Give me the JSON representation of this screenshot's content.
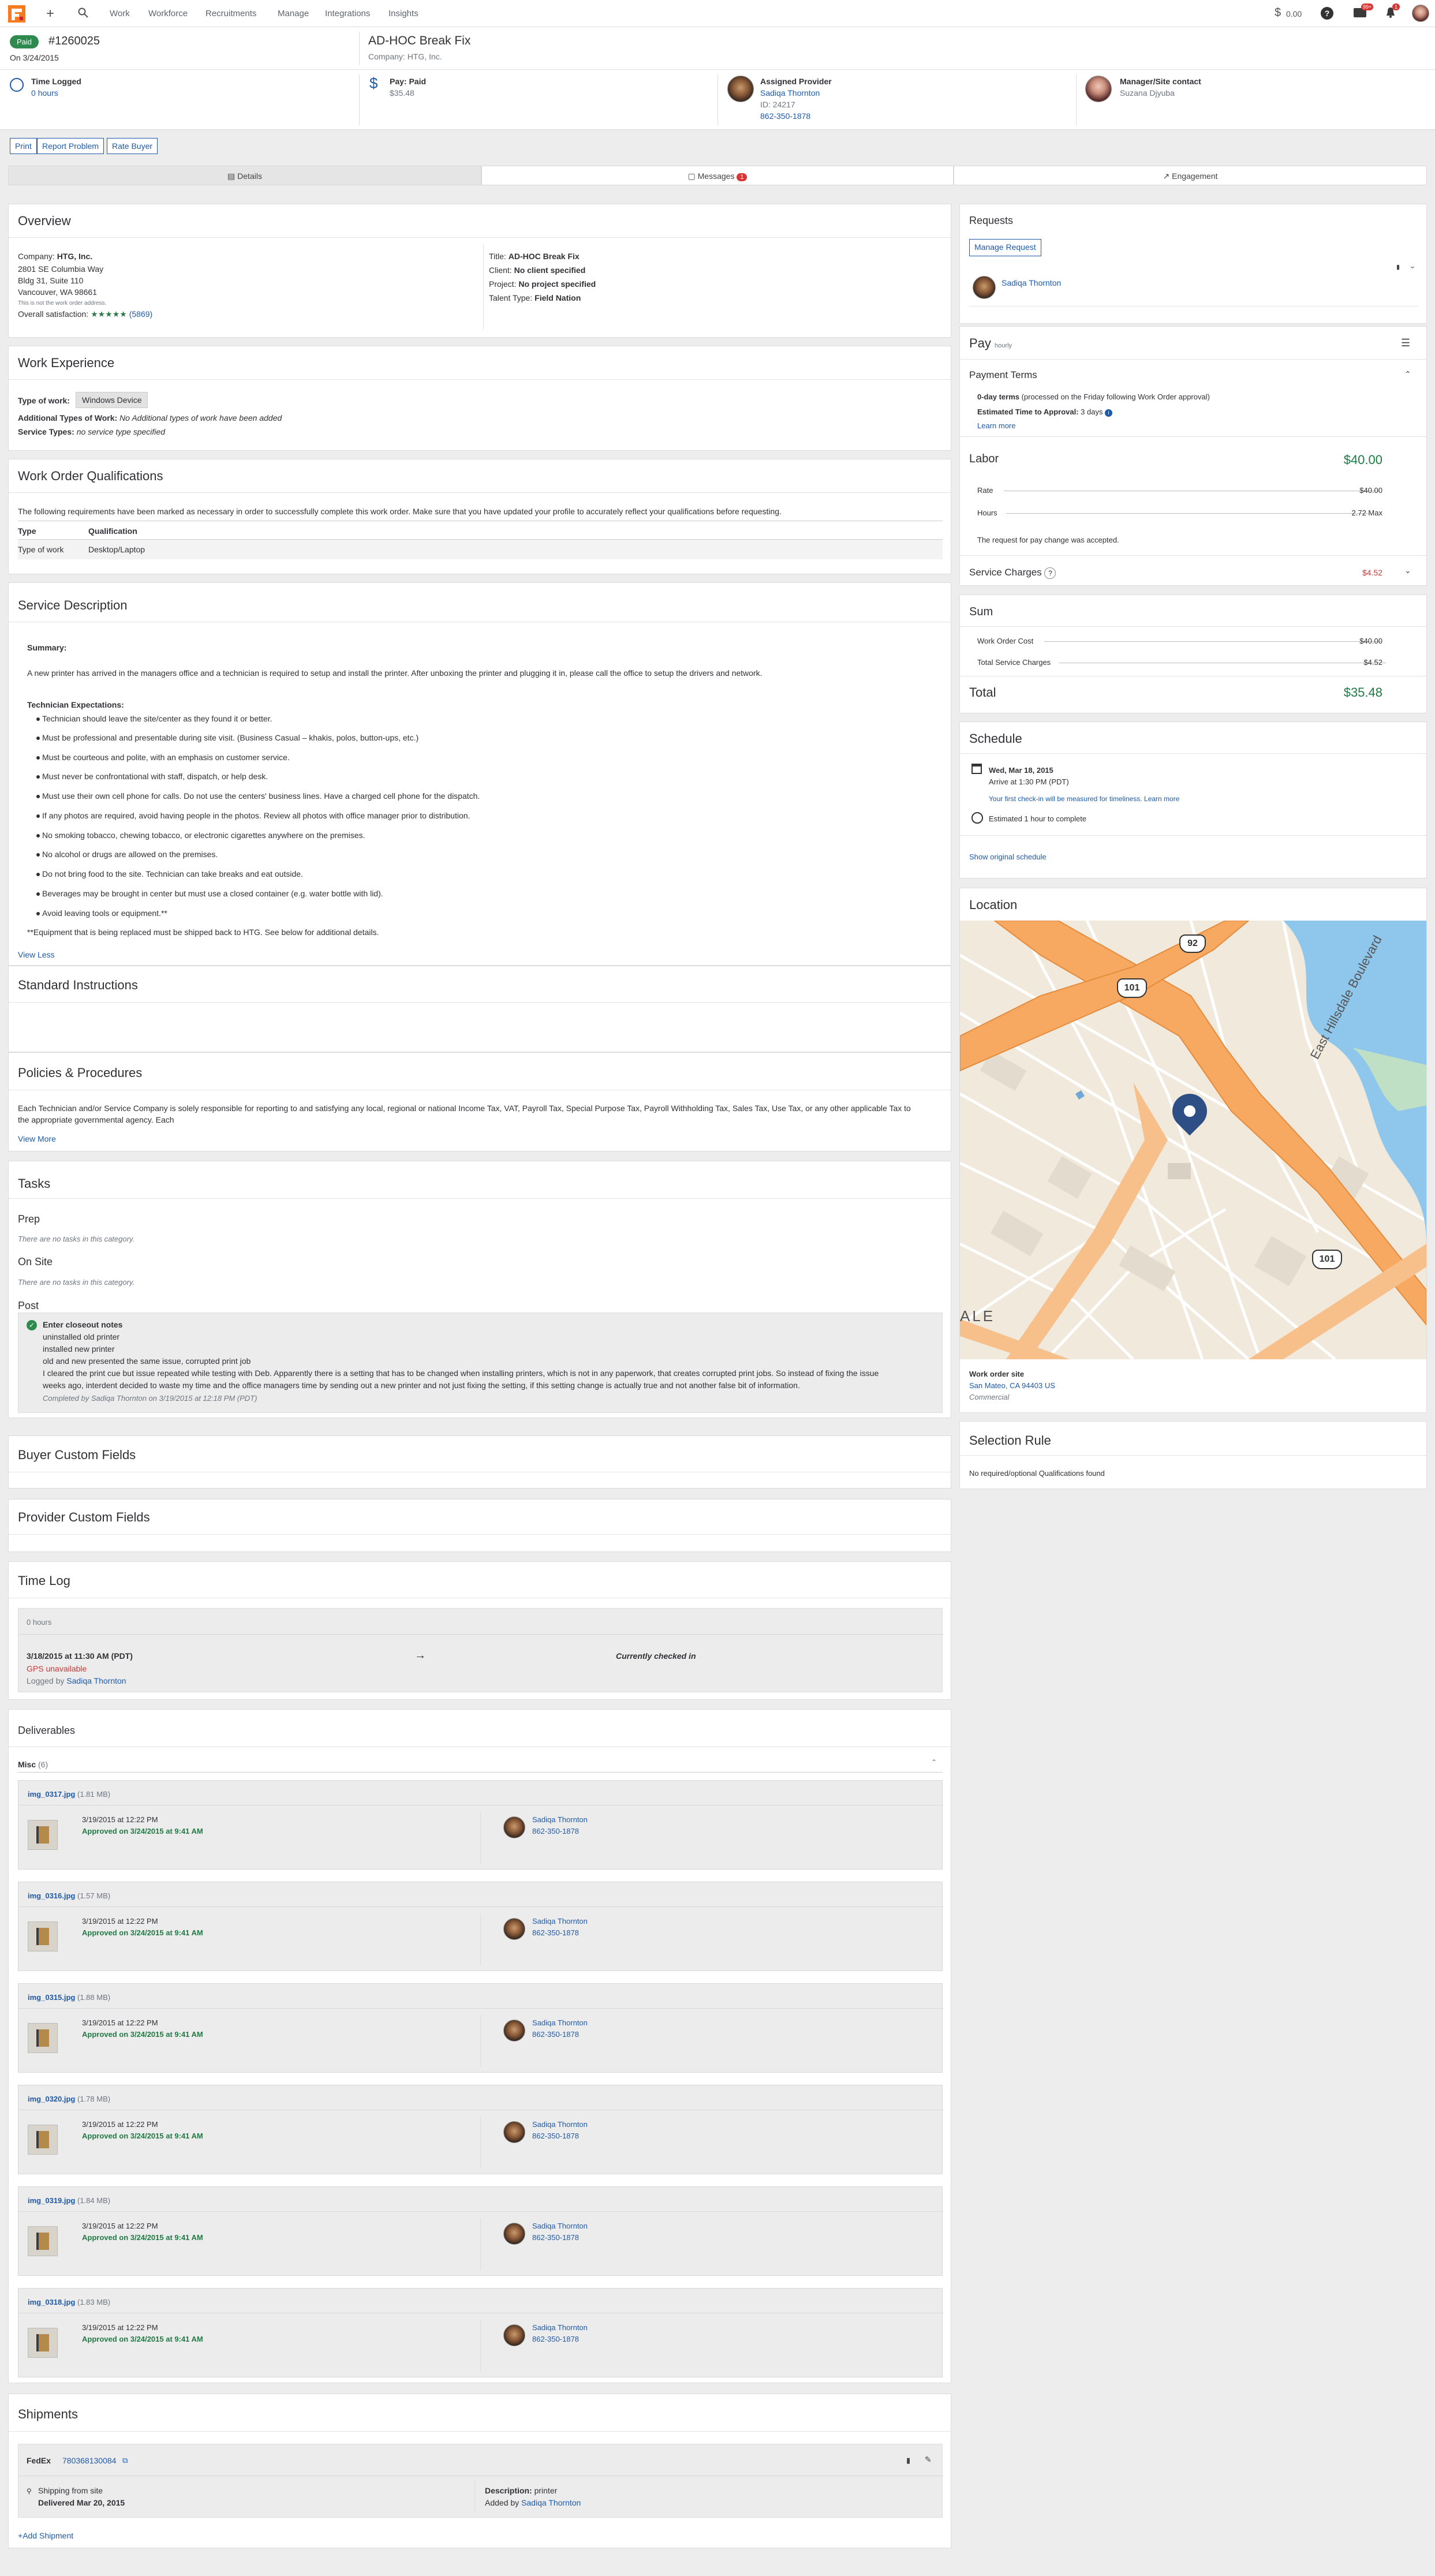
{
  "nav": {
    "items": [
      "Work",
      "Workforce",
      "Recruitments",
      "Manage",
      "Integrations",
      "Insights"
    ],
    "balance": "0.00",
    "msg_badge": "99+",
    "notif_badge": "1"
  },
  "header": {
    "status": "Paid",
    "wo_id": "#1260025",
    "date": "On 3/24/2015",
    "title": "AD-HOC Break Fix",
    "company_line": "Company: HTG, Inc."
  },
  "info": {
    "time_logged_label": "Time Logged",
    "time_logged_value": "0 hours",
    "pay_label": "Pay: Paid",
    "pay_value": "$35.48",
    "provider_label": "Assigned Provider",
    "provider_name": "Sadiqa Thornton",
    "provider_id": "ID: 24217",
    "provider_phone": "862-350-1878",
    "manager_label": "Manager/Site contact",
    "manager_name": "Suzana Djyuba"
  },
  "actions": [
    "Print",
    "Report Problem",
    "Rate Buyer"
  ],
  "tabs": {
    "details": "Details",
    "messages": "Messages",
    "messages_count": "1",
    "engagement": "Engagement"
  },
  "overview": {
    "title": "Overview",
    "company_label": "Company:",
    "company": "HTG, Inc.",
    "addr1": "2801 SE Columbia Way",
    "addr2": "Bldg 31, Suite 110",
    "addr3": "Vancouver, WA 98661",
    "note": "This is not the work order address.",
    "sat_label": "Overall satisfaction:",
    "sat_count": "(5869)",
    "title_label": "Title:",
    "title_value": "AD-HOC Break Fix",
    "client_label": "Client:",
    "client_value": "No client specified",
    "project_label": "Project:",
    "project_value": "No project specified",
    "talent_label": "Talent Type:",
    "talent_value": "Field Nation"
  },
  "work_experience": {
    "title": "Work Experience",
    "type_label": "Type of work:",
    "type_value": "Windows Device",
    "add_label": "Additional Types of Work:",
    "add_value": "No Additional types of work have been added",
    "svc_label": "Service Types:",
    "svc_value": "no service type specified"
  },
  "qualifications": {
    "title": "Work Order Qualifications",
    "intro": "The following requirements have been marked as necessary in order to successfully complete this work order. Make sure that you have updated your profile to accurately reflect your qualifications before requesting.",
    "col_type": "Type",
    "col_qual": "Qualification",
    "row_type": "Type of work",
    "row_qual": "Desktop/Laptop"
  },
  "service": {
    "title": "Service Description",
    "summary_label": "Summary:",
    "summary": "A new printer has arrived in the managers office and a technician is required to setup and install the printer. After unboxing the printer and plugging it in, please call the office to setup the drivers and network.",
    "expect_label": "Technician Expectations:",
    "bullets": [
      "Technician should leave the site/center as they found it or better.",
      "Must be professional and presentable during site visit. (Business Casual – khakis, polos, button-ups, etc.)",
      "Must be courteous and polite, with an emphasis on customer service.",
      "Must never be confrontational with staff, dispatch, or help desk.",
      "Must use their own cell phone for calls.  Do not use the centers' business lines. Have a charged cell phone for the dispatch.",
      "If any photos are required, avoid having people in the photos. Review all photos with office manager prior to distribution.",
      "No smoking tobacco, chewing tobacco, or electronic cigarettes anywhere on the premises.",
      "No alcohol or drugs are allowed on the premises.",
      "Do not bring food to the site. Technician can take breaks and eat outside.",
      "Beverages may be brought in center but must use a closed container (e.g. water bottle with lid).",
      "Avoid leaving tools or equipment.**"
    ],
    "footnote": "**Equipment that is being replaced must be shipped back to HTG.  See below for additional details.",
    "view_less": "View Less"
  },
  "standard": {
    "title": "Standard Instructions"
  },
  "policies": {
    "title": "Policies & Procedures",
    "text1": "Each Technician and/or Service Company is solely responsible for reporting to and satisfying any local, regional or national Income Tax, VAT, Payroll Tax, Special Purpose Tax, Payroll Withholding Tax, Sales Tax, Use Tax, or any other applicable Tax to",
    "text2": "the appropriate governmental agency. Each",
    "view_more": "View More"
  },
  "tasks": {
    "title": "Tasks",
    "prep": "Prep",
    "onsite": "On Site",
    "post": "Post",
    "empty": "There are no tasks in this category.",
    "closeout_title": "Enter closeout notes",
    "closeout_lines": [
      "uninstalled old printer",
      "installed new printer",
      "old and new presented the same issue, corrupted print job",
      "I cleared the print cue but issue repeated while testing with Deb. Apparently there is a setting that has to be changed when installing printers, which is not in any paperwork, that creates corrupted print jobs. So instead of fixing the issue",
      "weeks ago, interdent decided to waste my time and the office managers time by sending out a new printer and not just fixing the setting, if this setting change is actually true and not another false bit of information."
    ],
    "completed": "Completed by Sadiqa Thornton on 3/19/2015 at 12:18 PM (PDT)"
  },
  "buyer_fields": {
    "title": "Buyer Custom Fields"
  },
  "provider_fields": {
    "title": "Provider Custom Fields"
  },
  "timelog": {
    "title": "Time Log",
    "hours": "0 hours",
    "checkin": "3/18/2015 at 11:30 AM (PDT)",
    "gps": "GPS unavailable",
    "logged_by": "Logged by",
    "logged_name": "Sadiqa Thornton",
    "status": "Currently checked in"
  },
  "deliverables": {
    "title": "Deliverables",
    "group": "Misc",
    "group_count": "(6)",
    "approved": "Approved on 3/24/2015 at 9:41 AM",
    "uploaded": "3/19/2015 at 12:22 PM",
    "provider": "Sadiqa Thornton",
    "phone": "862-350-1878",
    "files": [
      {
        "name": "img_0317.jpg",
        "size": "(1.81 MB)"
      },
      {
        "name": "img_0316.jpg",
        "size": "(1.57 MB)"
      },
      {
        "name": "img_0315.jpg",
        "size": "(1.88 MB)"
      },
      {
        "name": "img_0320.jpg",
        "size": "(1.78 MB)"
      },
      {
        "name": "img_0319.jpg",
        "size": "(1.84 MB)"
      },
      {
        "name": "img_0318.jpg",
        "size": "(1.83 MB)"
      }
    ]
  },
  "shipments": {
    "title": "Shipments",
    "carrier": "FedEx",
    "tracking": "780368130084",
    "from": "Shipping from site",
    "delivered": "Delivered Mar 20, 2015",
    "desc_label": "Description:",
    "desc_value": "printer",
    "added_by": "Added by",
    "added_name": "Sadiqa Thornton",
    "add": "Add Shipment"
  },
  "requests": {
    "title": "Requests",
    "manage": "Manage Request",
    "name": "Sadiqa Thornton"
  },
  "pay": {
    "title": "Pay",
    "unit": "hourly",
    "terms_title": "Payment Terms",
    "terms_bold": "0-day terms",
    "terms_rest": " (processed on the Friday following Work Order approval)",
    "approval_label": "Estimated Time to Approval:",
    "approval_value": "3 days",
    "learn": "Learn more",
    "labor": "Labor",
    "labor_value": "$40.00",
    "rate": "Rate",
    "rate_value": "$40.00",
    "hours": "Hours",
    "hours_value": "2.72 Max",
    "accepted": "The request for pay change was accepted.",
    "svc": "Service Charges",
    "svc_value": "$4.52",
    "sum": "Sum",
    "woc": "Work Order Cost",
    "woc_value": "$40.00",
    "tsc": "Total Service Charges",
    "tsc_value": "$4.52",
    "total": "Total",
    "total_value": "$35.48"
  },
  "schedule": {
    "title": "Schedule",
    "date": "Wed, Mar 18, 2015",
    "arrive": "Arrive at 1:30 PM (PDT)",
    "note": "Your first check-in will be measured for timeliness.",
    "learn": "Learn more",
    "estimate": "Estimated 1 hour to complete",
    "show": "Show original schedule"
  },
  "location": {
    "title": "Location",
    "site_label": "Work order site",
    "addr": "San Mateo, CA 94403 US",
    "type": "Commercial",
    "road1": "92",
    "road2": "101",
    "road3": "101",
    "street": "East Hillsdale Boulevard",
    "area": "ALE"
  },
  "selection": {
    "title": "Selection Rule",
    "text": "No required/optional Qualifications found"
  },
  "colors": {
    "brand": "#f47b20",
    "paid": "#2f8a4f",
    "link": "#1f5aa8",
    "green": "#1f7a45",
    "red": "#c73838"
  }
}
